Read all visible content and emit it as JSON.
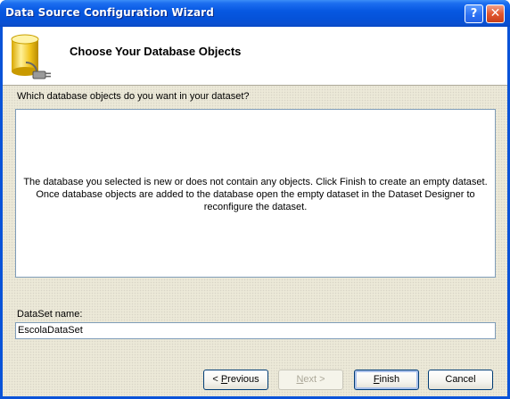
{
  "window": {
    "title": "Data Source Configuration Wizard",
    "help_label": "?",
    "close_label": "✕"
  },
  "header": {
    "title": "Choose Your Database Objects",
    "icon": "database-plug-icon"
  },
  "main": {
    "question": "Which database objects do you want in your dataset?",
    "empty_message_line1": "The database you selected is new or does not contain any objects. Click Finish to create an empty dataset.",
    "empty_message_line2": "Once database objects are added to the database open the empty dataset in the Dataset Designer to",
    "empty_message_line3": "reconfigure the dataset.",
    "dataset_name_label": "DataSet name:",
    "dataset_name_value": "EscolaDataSet"
  },
  "buttons": {
    "previous_prefix": "< ",
    "previous_accel": "P",
    "previous_rest": "revious",
    "next_accel": "N",
    "next_rest": "ext >",
    "finish_accel": "F",
    "finish_rest": "inish",
    "cancel": "Cancel"
  },
  "colors": {
    "titlebar": "#0552d9",
    "client_bg": "#ece9d8",
    "field_border": "#7f9db9"
  }
}
